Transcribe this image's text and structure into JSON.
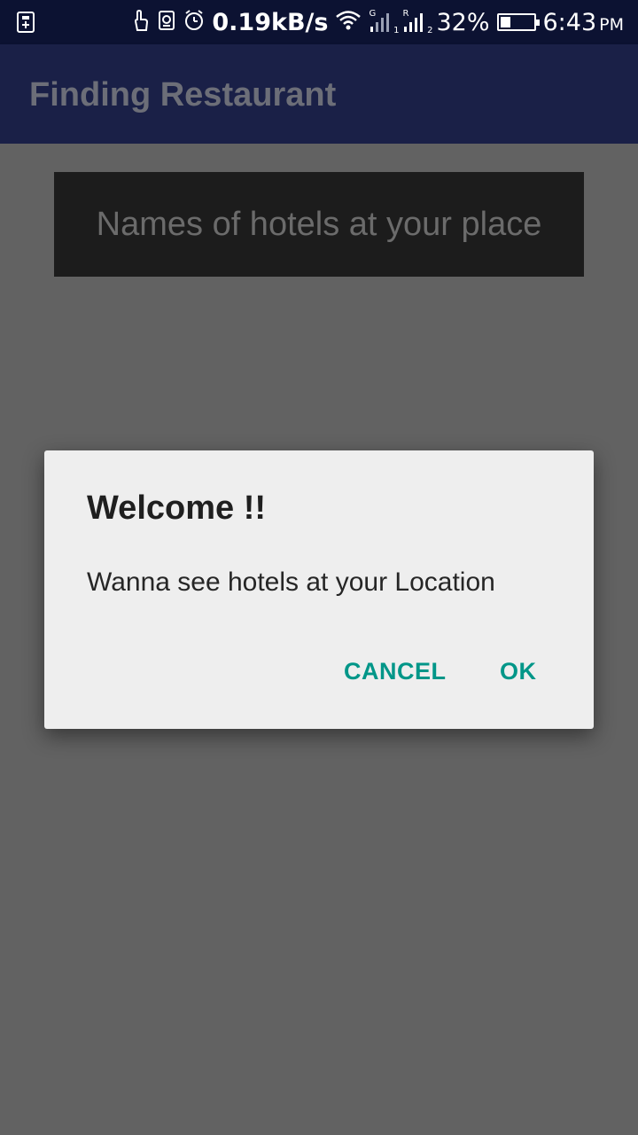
{
  "status_bar": {
    "net_speed": "0.19kB/s",
    "sim1_label": "G",
    "sim1_index": "1",
    "sim2_label": "R",
    "sim2_index": "2",
    "battery_percent": "32%",
    "battery_level": 0.32,
    "time": "6:43",
    "ampm": "PM",
    "icons": [
      "usb-icon",
      "touch-icon",
      "sim-card-icon",
      "alarm-icon",
      "wifi-icon",
      "signal-icon",
      "signal-icon",
      "battery-icon"
    ]
  },
  "app_bar": {
    "title": "Finding Restaurant"
  },
  "main": {
    "hotels_label": "Names of hotels at your place"
  },
  "dialog": {
    "title": "Welcome !!",
    "message": "Wanna see hotels at your Location",
    "cancel_label": "CANCEL",
    "ok_label": "OK"
  },
  "colors": {
    "status_bar": "#0c1232",
    "app_bar": "#1a2047",
    "scrim_background": "#626262",
    "dialog_background": "#eeeeee",
    "accent": "#009688"
  }
}
